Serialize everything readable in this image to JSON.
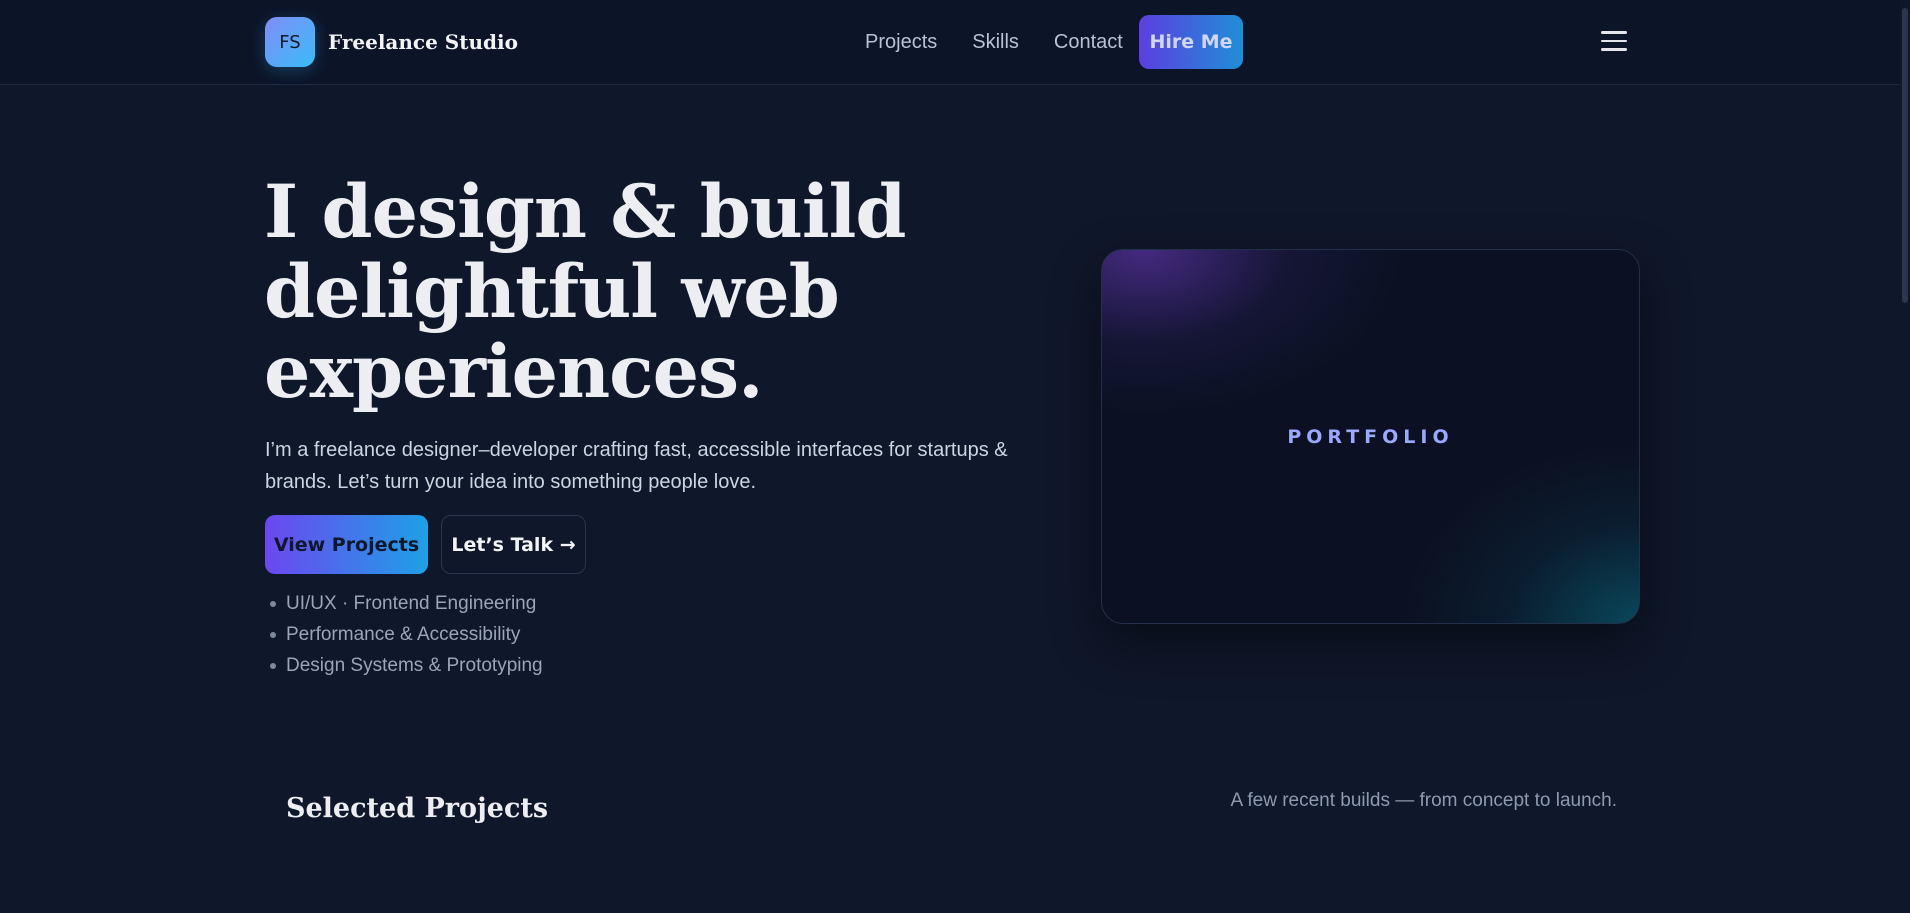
{
  "header": {
    "logo_initials": "FS",
    "brand_name": "Freelance Studio",
    "nav": [
      "Projects",
      "Skills",
      "Contact"
    ],
    "cta_label": "Hire Me",
    "menu_icon": "hamburger-menu-icon"
  },
  "hero": {
    "title": "I design & build delightful web experiences.",
    "subtitle": "I’m a freelance designer–developer crafting fast, accessible interfaces for startups & brands. Let’s turn your idea into something people love.",
    "primary_button": "View Projects",
    "secondary_button": "Let’s Talk →",
    "skills": [
      "UI/UX · Frontend Engineering",
      "Performance & Accessibility",
      "Design Systems & Prototyping"
    ]
  },
  "portfolio_card": {
    "label": "PORTFOLIO"
  },
  "projects_section": {
    "title": "Selected Projects",
    "subtitle": "A few recent builds — from concept to launch."
  },
  "colors": {
    "background": "#0f172a",
    "accent_start": "#6d47f0",
    "accent_end": "#1da1e6"
  }
}
